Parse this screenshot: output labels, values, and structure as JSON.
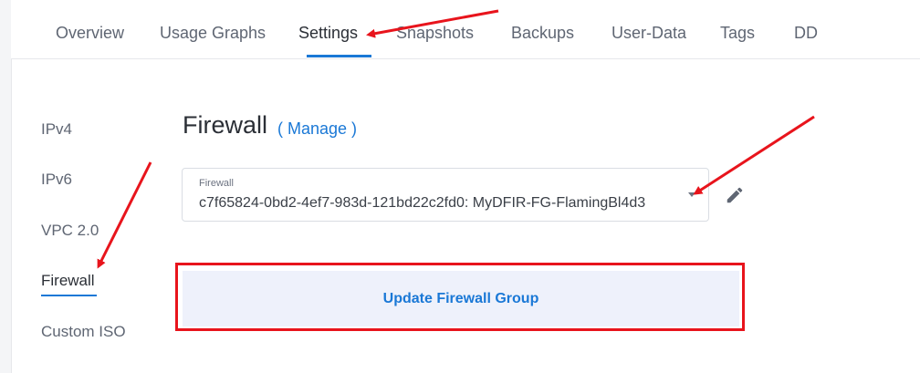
{
  "tabs": [
    {
      "label": "Overview"
    },
    {
      "label": "Usage Graphs"
    },
    {
      "label": "Settings"
    },
    {
      "label": "Snapshots"
    },
    {
      "label": "Backups"
    },
    {
      "label": "User-Data"
    },
    {
      "label": "Tags"
    },
    {
      "label": "DD"
    }
  ],
  "active_tab": "Settings",
  "sidebar": {
    "items": [
      {
        "label": "IPv4"
      },
      {
        "label": "IPv6"
      },
      {
        "label": "VPC 2.0"
      },
      {
        "label": "Firewall"
      },
      {
        "label": "Custom ISO"
      }
    ],
    "active": "Firewall"
  },
  "section": {
    "title": "Firewall",
    "manage_link": "( Manage )"
  },
  "firewall_select": {
    "label": "Firewall",
    "value": "c7f65824-0bd2-4ef7-983d-121bd22c2fd0: MyDFIR-FG-FlamingBl4d3"
  },
  "update_button": {
    "label": "Update Firewall Group"
  },
  "icons": {
    "edit": "pencil-icon",
    "caret": "caret-down-icon"
  },
  "colors": {
    "accent": "#1a78d6",
    "annotation": "#e8141c",
    "button_bg": "#eef1fb"
  }
}
